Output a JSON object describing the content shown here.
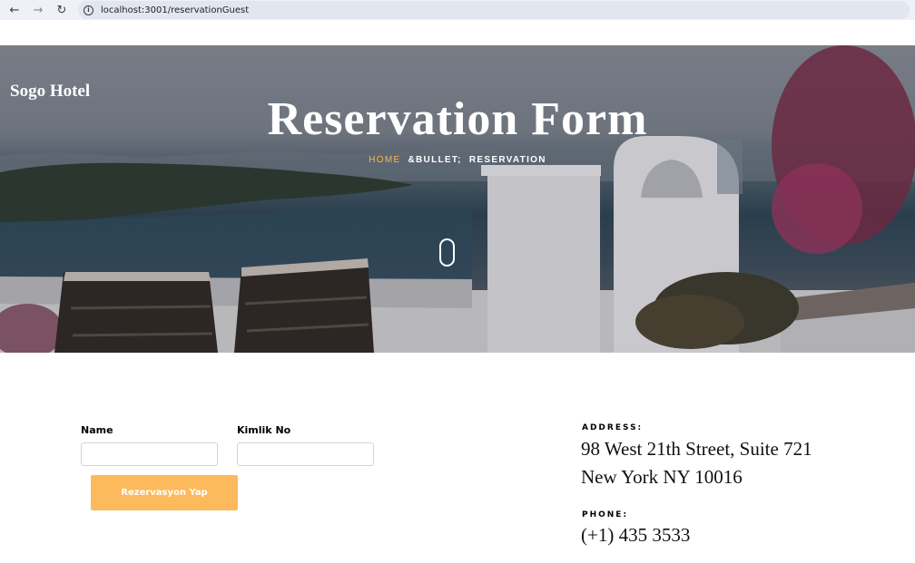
{
  "browser": {
    "url": "localhost:3001/reservationGuest",
    "back_icon": "arrow-left-icon",
    "forward_icon": "arrow-right-icon",
    "reload_icon": "reload-icon",
    "info_icon": "info-icon"
  },
  "hero": {
    "brand": "Sogo Hotel",
    "title": "Reservation Form",
    "breadcrumb": {
      "home": "HOME",
      "separator": "&BULLET;",
      "current": "RESERVATION"
    },
    "scroll_icon": "mouse-icon",
    "accent_color": "#f7b655"
  },
  "form": {
    "name_label": "Name",
    "name_value": "",
    "kimlik_label": "Kimlik No",
    "kimlik_value": "",
    "submit_label": "Rezervasyon Yap",
    "submit_color": "#fdba5c"
  },
  "contact": {
    "address_label": "ADDRESS:",
    "address_line1": "98 West 21th Street, Suite 721",
    "address_line2": "New York NY 10016",
    "phone_label": "PHONE:",
    "phone_value": "(+1) 435 3533"
  }
}
